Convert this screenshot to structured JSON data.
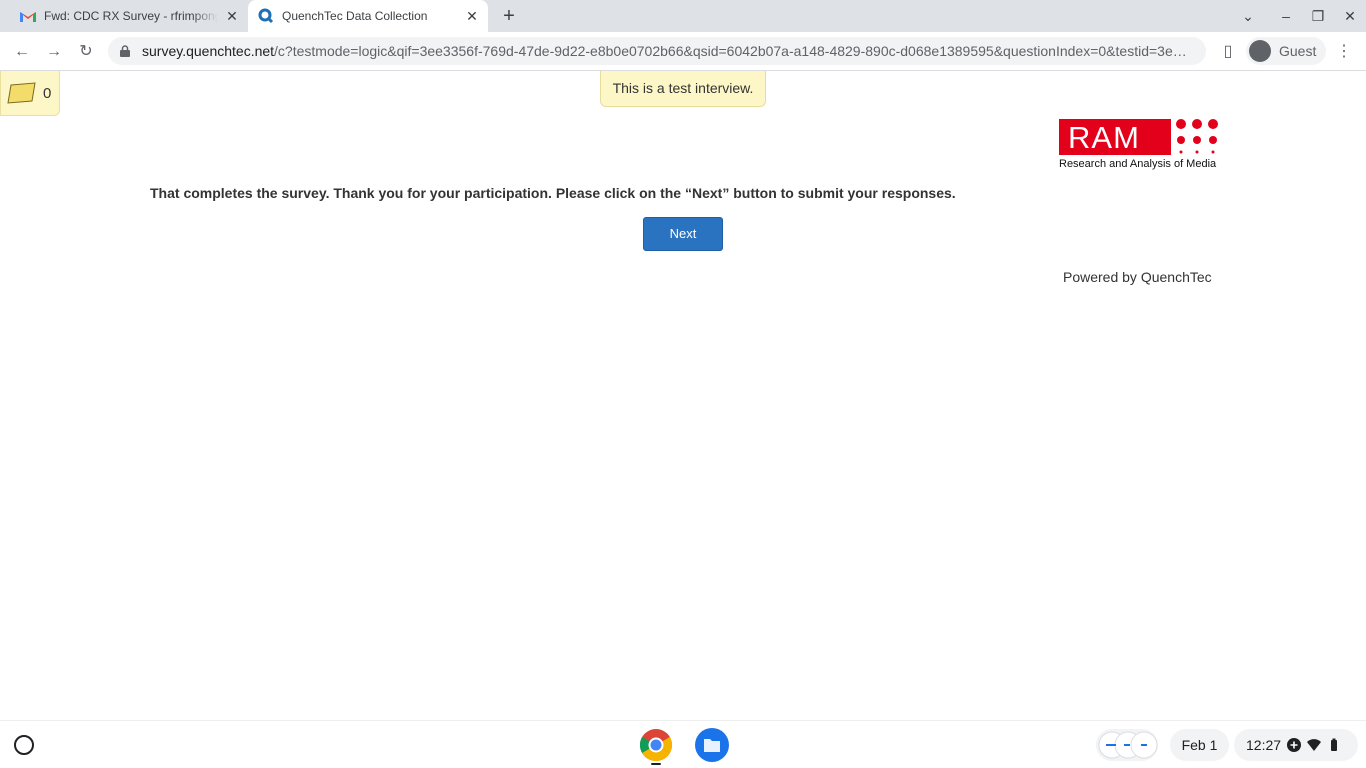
{
  "browser": {
    "tabs": [
      {
        "title": "Fwd: CDC RX Survey - rfrimpong",
        "icon": "gmail-icon"
      },
      {
        "title": "QuenchTec Data Collection",
        "icon": "quenchtec-icon",
        "active": true
      }
    ],
    "url_host": "survey.quenchtec.net",
    "url_path": "/c?testmode=logic&qif=3ee3356f-769d-47de-9d22-e8b0e0702b66&qsid=6042b07a-a148-4829-890c-d068e1389595&questionIndex=0&testid=3e…",
    "profile_label": "Guest"
  },
  "page": {
    "notes_count": "0",
    "test_banner": "This is a test interview.",
    "logo": {
      "text": "RAM",
      "tagline": "Research and Analysis of Media",
      "brand_color": "#e2001a"
    },
    "message": "That completes the survey. Thank you for your participation. Please click on the “Next” button to submit your responses.",
    "next_label": "Next",
    "powered_by": "Powered by QuenchTec",
    "button_color": "#2a73c0"
  },
  "shelf": {
    "date": "Feb 1",
    "time": "12:27",
    "apps": [
      "chrome-icon",
      "files-icon"
    ]
  }
}
